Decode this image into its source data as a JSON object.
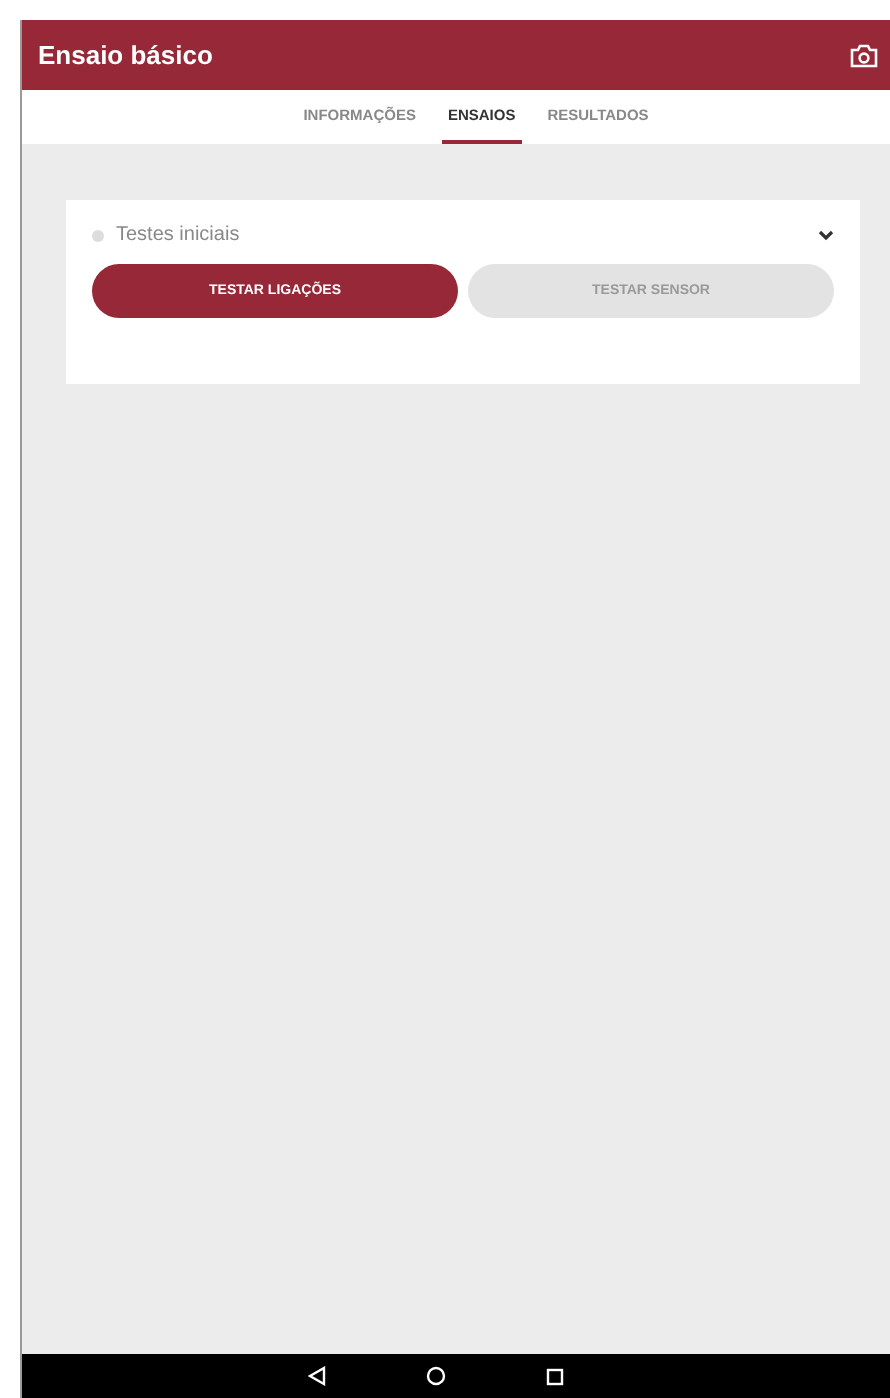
{
  "app_bar": {
    "title": "Ensaio básico"
  },
  "tabs": [
    {
      "label": "INFORMAÇÕES",
      "selected": false
    },
    {
      "label": "ENSAIOS",
      "selected": true
    },
    {
      "label": "RESULTADOS",
      "selected": false
    }
  ],
  "section": {
    "title": "Testes iniciais",
    "buttons": [
      {
        "label": "TESTAR LIGAÇÕES",
        "disabled": false
      },
      {
        "label": "TESTAR SENSOR",
        "disabled": true
      }
    ]
  }
}
